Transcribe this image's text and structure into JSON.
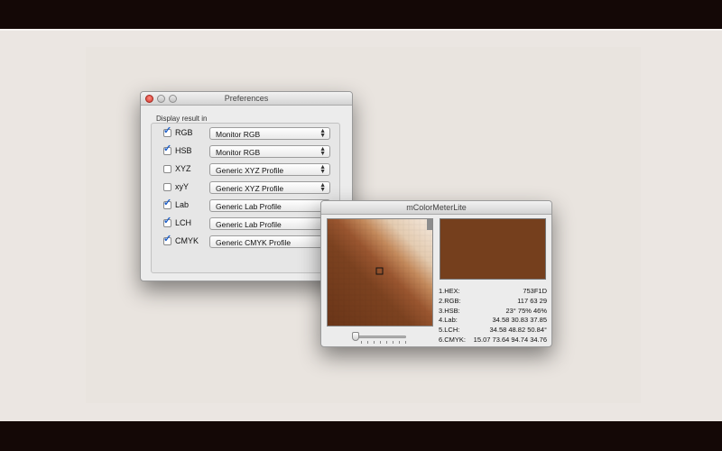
{
  "preferences": {
    "title": "Preferences",
    "group_label": "Display result in",
    "rows": [
      {
        "label": "RGB",
        "checked": true,
        "profile": "Monitor RGB"
      },
      {
        "label": "HSB",
        "checked": true,
        "profile": "Monitor RGB"
      },
      {
        "label": "XYZ",
        "checked": false,
        "profile": "Generic XYZ Profile"
      },
      {
        "label": "xyY",
        "checked": false,
        "profile": "Generic XYZ Profile"
      },
      {
        "label": "Lab",
        "checked": true,
        "profile": "Generic Lab Profile"
      },
      {
        "label": "LCH",
        "checked": true,
        "profile": "Generic Lab Profile"
      },
      {
        "label": "CMYK",
        "checked": true,
        "profile": "Generic CMYK Profile"
      }
    ]
  },
  "meter": {
    "title": "mColorMeterLite",
    "swatch_color": "#753F1D",
    "zoom_level": 0.0,
    "readouts": [
      {
        "label": "1.HEX:",
        "value": "753F1D"
      },
      {
        "label": "2.RGB:",
        "value": "117 63 29"
      },
      {
        "label": "3.HSB:",
        "value": "23° 75% 46%"
      },
      {
        "label": "4.Lab:",
        "value": "34.58 30.83 37.85"
      },
      {
        "label": "5.LCH:",
        "value": "34.58 48.82 50.84°"
      },
      {
        "label": "6.CMYK:",
        "value": "15.07 73.64 94.74 34.76"
      }
    ]
  },
  "colors": {
    "accent": "#2060c8",
    "sample_dark": "#753F1D",
    "sample_light": "#f3e6d6"
  }
}
